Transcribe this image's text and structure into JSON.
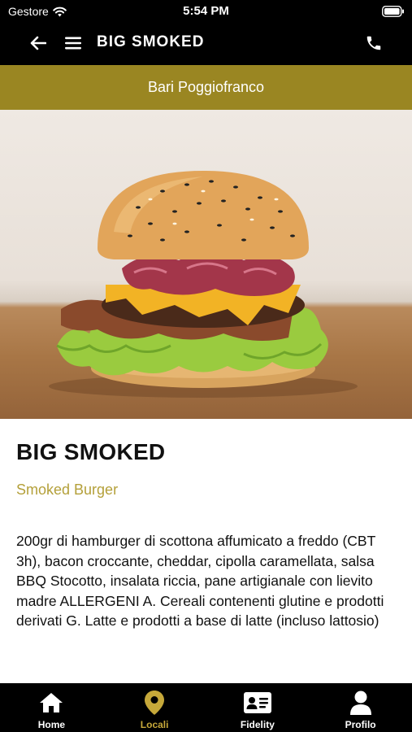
{
  "status_bar": {
    "carrier": "Gestore",
    "time": "5:54 PM"
  },
  "nav": {
    "title": "BIG SMOKED",
    "icons": [
      "back-arrow-icon",
      "hamburger-menu-icon",
      "phone-icon"
    ]
  },
  "location": {
    "name": "Bari Poggiofranco"
  },
  "product": {
    "title": "BIG SMOKED",
    "category": "Smoked Burger",
    "description": "200gr di hamburger di scottona affumicato a freddo (CBT 3h), bacon croccante, cheddar, cipolla caramellata, salsa BBQ Stocotto, insalata riccia, pane artigianale con lievito madre ALLERGENI A. Cereali contenenti glutine e prodotti derivati G. Latte e prodotti a base di latte (incluso lattosio)"
  },
  "tabbar": {
    "items": [
      {
        "label": "Home",
        "icon": "home-icon",
        "active": false
      },
      {
        "label": "Locali",
        "icon": "map-pin-icon",
        "active": true
      },
      {
        "label": "Fidelity",
        "icon": "id-card-icon",
        "active": false
      },
      {
        "label": "Profilo",
        "icon": "user-icon",
        "active": false
      }
    ]
  },
  "colors": {
    "accent": "#9a8622",
    "category_text": "#b4a03a",
    "active_tab": "#c6a83a",
    "bars": "#000000"
  }
}
